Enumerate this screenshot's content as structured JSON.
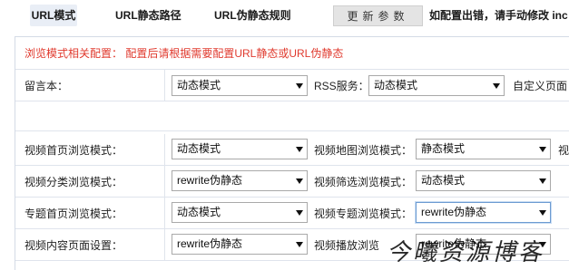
{
  "tabs": [
    {
      "label": "URL模式",
      "active": true
    },
    {
      "label": "URL静态路径",
      "active": false
    },
    {
      "label": "URL伪静态规则",
      "active": false
    }
  ],
  "update_button": "更新参数",
  "tip": "如配置出错，请手动修改 inc",
  "notice": "浏览模式相关配置： 配置后请根据需要配置URL静态或URL伪静态",
  "rows": {
    "guestbook": {
      "label": "留言本：",
      "value": "动态模式"
    },
    "rss": {
      "label": "RSS服务：",
      "value": "动态模式"
    },
    "custom_page": {
      "label": "自定义页面"
    },
    "video_home": {
      "label": "视频首页浏览模式：",
      "value": "动态模式"
    },
    "video_map": {
      "label": "视频地图浏览模式：",
      "value": "静态模式"
    },
    "video_cut": {
      "label": "视"
    },
    "video_cat": {
      "label": "视频分类浏览模式：",
      "value": "rewrite伪静态"
    },
    "video_filter": {
      "label": "视频筛选浏览模式：",
      "value": "动态模式"
    },
    "topic_home": {
      "label": "专题首页浏览模式：",
      "value": "动态模式"
    },
    "topic_video": {
      "label": "视频专题浏览模式：",
      "value": "rewrite伪静态"
    },
    "content": {
      "label": "视频内容页面设置：",
      "value": "rewrite伪静态"
    },
    "play": {
      "label": "视频播放浏览",
      "value": "rewrite伪静态"
    }
  },
  "watermark": "今曦资源博客"
}
